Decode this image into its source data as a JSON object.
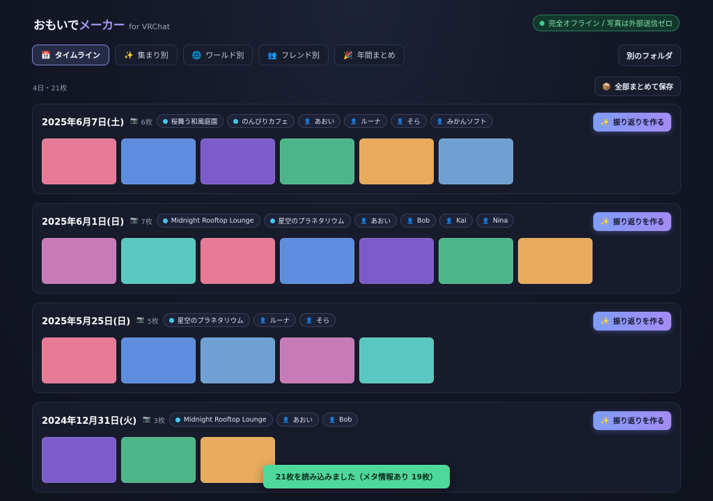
{
  "app": {
    "title_main": "おもいで",
    "title_accent": "メーカー",
    "title_sub": "for VRChat"
  },
  "offline_badge": "完全オフライン / 写真は外部送信ゼロ",
  "tabs": [
    {
      "label": "タイムライン",
      "icon": "calendar-icon",
      "glyph": "📅",
      "active": true
    },
    {
      "label": "集まり別",
      "icon": "sparkle-icon",
      "glyph": "✨",
      "active": false
    },
    {
      "label": "ワールド別",
      "icon": "globe-icon",
      "glyph": "🌐",
      "active": false
    },
    {
      "label": "フレンド別",
      "icon": "people-icon",
      "glyph": "👥",
      "active": false
    },
    {
      "label": "年間まとめ",
      "icon": "party-popper-icon",
      "glyph": "🎉",
      "active": false
    }
  ],
  "other_folder_label": "別のフォルダ",
  "summary": "4日・21枚",
  "save_all": {
    "label": "全部まとめて保存",
    "icon": "package-icon",
    "glyph": "📦"
  },
  "recap_label": "振り返りを作る",
  "recap_glyph": "✨",
  "days": [
    {
      "date": "2025年6月7日(土)",
      "count": "6枚",
      "worlds": [
        "桜舞う和風庭園",
        "のんびりカフェ"
      ],
      "friends": [
        "あおい",
        "ルーナ",
        "そら",
        "みかんソフト"
      ],
      "photos": [
        "#e77a96",
        "#5d8ddc",
        "#7c5cc9",
        "#4eb58a",
        "#e8aa5c",
        "#6fa0d2"
      ]
    },
    {
      "date": "2025年6月1日(日)",
      "count": "7枚",
      "worlds": [
        "Midnight Rooftop Lounge",
        "星空のプラネタリウム"
      ],
      "friends": [
        "あおい",
        "Bob",
        "Kai",
        "Nina"
      ],
      "photos": [
        "#c67bb6",
        "#5ac8c0",
        "#e77a96",
        "#5d8ddc",
        "#7c5cc9",
        "#4eb58a",
        "#e8aa5c"
      ]
    },
    {
      "date": "2025年5月25日(日)",
      "count": "5枚",
      "worlds": [
        "星空のプラネタリウム"
      ],
      "friends": [
        "ルーナ",
        "そら"
      ],
      "photos": [
        "#e77a96",
        "#5d8ddc",
        "#6fa0d2",
        "#c67bb6",
        "#5ac8c0"
      ]
    },
    {
      "date": "2024年12月31日(火)",
      "count": "3枚",
      "worlds": [
        "Midnight Rooftop Lounge"
      ],
      "friends": [
        "あおい",
        "Bob"
      ],
      "photos": [
        "#7c5cc9",
        "#4eb58a",
        "#e8aa5c"
      ]
    }
  ],
  "toast": "21枚を読み込みました（メタ情報あり 19枚）"
}
